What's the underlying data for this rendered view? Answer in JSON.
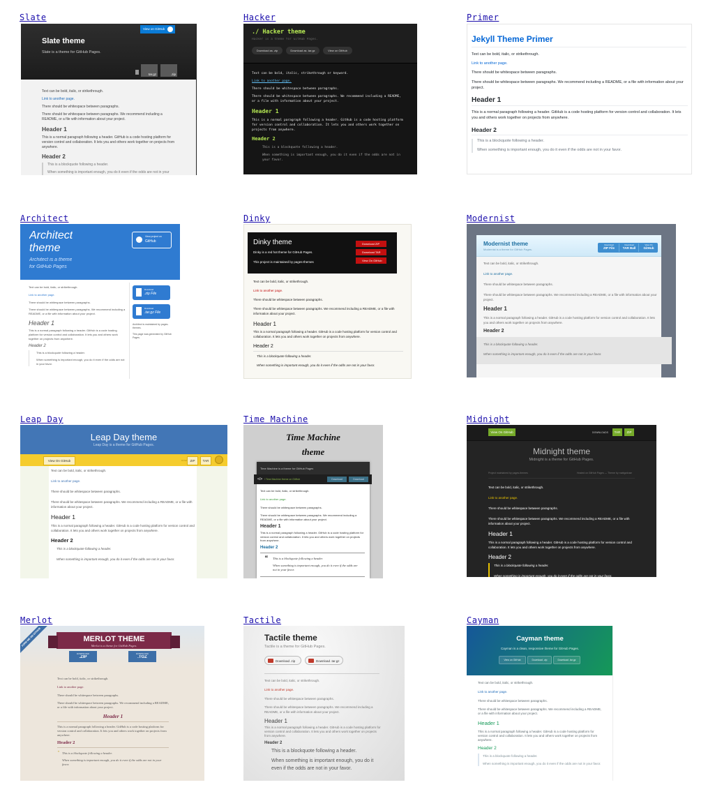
{
  "themes": [
    {
      "name": "Slate"
    },
    {
      "name": "Hacker"
    },
    {
      "name": "Primer"
    },
    {
      "name": "Architect"
    },
    {
      "name": "Dinky"
    },
    {
      "name": "Modernist"
    },
    {
      "name": "Leap Day"
    },
    {
      "name": "Time Machine"
    },
    {
      "name": "Midnight"
    },
    {
      "name": "Merlot"
    },
    {
      "name": "Tactile"
    },
    {
      "name": "Cayman"
    }
  ],
  "common": {
    "text_line": "Text can be bold, italic, or strikethrough.",
    "link": "Link to another page.",
    "p1": "There should be whitespace between paragraphs.",
    "p2": "There should be whitespace between paragraphs. We recommend including a README, or a file with information about your project.",
    "h1": "Header 1",
    "p3": "This is a normal paragraph following a header. GitHub is a code hosting platform for version control and collaboration. It lets you and others work together on projects from anywhere.",
    "h2": "Header 2",
    "bq1": "This is a blockquote following a header.",
    "bq2": "When something is important enough, you do it even if the odds are not in your favor."
  },
  "slate": {
    "title": "Slate theme",
    "tagline": "Slate is a theme for GitHub Pages.",
    "view_btn": "View on GitHub",
    "tar": "tar.gz",
    "zip": ".zip"
  },
  "hacker": {
    "title": "./ Hacker theme",
    "tagline": "Hacker is a theme for GitHub Pages.",
    "btn_zip": "Download as .zip",
    "btn_tar": "Download as .tar.gz",
    "btn_gh": "View on GitHub",
    "text_line": "Text can be bold, italic, strikethrough or keyword."
  },
  "primer": {
    "title": "Jekyll Theme Primer"
  },
  "architect": {
    "title_1": "Architect",
    "title_2": "theme",
    "tagline_1": "Architect is a theme",
    "tagline_2": "for GitHub Pages",
    "view_small": "View project on",
    "view_big": "GitHub",
    "dl_small": "Download",
    "zip": ".zip File",
    "tar": ".tar.gz File",
    "maintained": "Architect is maintained by pages-themes.",
    "generated": "This page was generated by GitHub Pages."
  },
  "dinky": {
    "title": "Dinky theme",
    "tagline": "Dinky is a red hot theme for GitHub Pages.",
    "maintained": "This project is maintained by pages-themes",
    "btn_zip": "Download ZIP",
    "btn_tar": "Download TAR",
    "btn_gh": "View On GitHub"
  },
  "modernist": {
    "title": "Modernist theme",
    "tagline": "Modernist is a theme for GitHub Pages.",
    "dl": "Download",
    "zip": "ZIP File",
    "tar": "TAR Ball",
    "view": "View On",
    "gh": "GitHub"
  },
  "leapday": {
    "title": "Leap Day theme",
    "tagline": "Leap Day is a theme for GitHub Pages.",
    "view_btn": "View On GitHub",
    "downloads": "DOWNLOADS",
    "zip": "ZIP",
    "tar": "TAR"
  },
  "timemachine": {
    "title_1": "Time Machine",
    "title_2": "theme",
    "window_title": "Time Machine is a theme for GitHub Pages",
    "path": "/ Time Machine theme on GitHub",
    "dl1": "Download",
    "dl2": "Download"
  },
  "midnight": {
    "view_btn": "View On GitHub",
    "downloads": "DOWNLOADS",
    "tar": "TAR",
    "zip": "ZIP",
    "title": "Midnight theme",
    "tagline": "Midnight is a theme for GitHub Pages.",
    "maintained": "Project maintained by pages-themes",
    "hosted": "Hosted on GitHub Pages — Theme by mattgraham"
  },
  "merlot": {
    "ribbon": "FORK ME ON GITHUB",
    "title": "MERLOT THEME",
    "tagline": "Merlot is a theme for GitHub Pages.",
    "dl": "DOWNLOAD",
    "zip": ".ZIP",
    "tgz": ".TGZ"
  },
  "tactile": {
    "title": "Tactile theme",
    "tagline": "Tactile is a theme for GitHub Pages.",
    "zip": "Download .zip",
    "tar": "Download .tar.gz"
  },
  "cayman": {
    "title": "Cayman theme",
    "tagline": "Cayman is a clean, responsive theme for GitHub Pages.",
    "btn_gh": "View on GitHub",
    "btn_zip": "Download .zip",
    "btn_tar": "Download .tar.gz"
  }
}
